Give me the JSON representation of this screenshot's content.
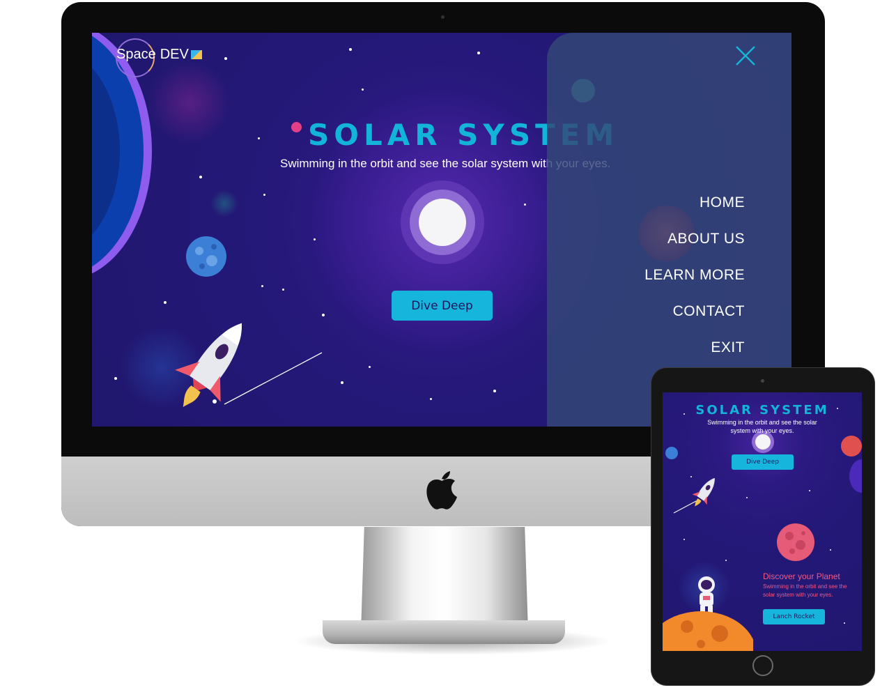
{
  "desktop": {
    "brand": {
      "name_part1": "Space",
      "name_part2": "DEV"
    },
    "hero": {
      "title": "SOLAR SYSTEM",
      "subtitle": "Swimming in the orbit and see the solar system with your eyes.",
      "cta_label": "Dive Deep"
    },
    "menu": {
      "items": [
        "HOME",
        "ABOUT US",
        "LEARN MORE",
        "CONTACT",
        "EXIT"
      ]
    }
  },
  "tablet": {
    "hero": {
      "title": "SOLAR SYSTEM",
      "subtitle": "Swimming in the orbit and see the solar system with your eyes.",
      "cta_label": "Dive Deep"
    },
    "discover": {
      "title": "Discover your Planet",
      "text": "Swimming in the orbit and see the solar system with your eyes.",
      "cta_label": "Lanch Rocket"
    }
  },
  "colors": {
    "accent": "#16b6dc",
    "background": "#241878",
    "menu_panel": "#344878",
    "discover_text": "#f05a86"
  },
  "icons": [
    "close-icon",
    "apple-logo-icon",
    "rocket-icon",
    "planet-icon",
    "moon-icon",
    "astronaut-icon"
  ]
}
